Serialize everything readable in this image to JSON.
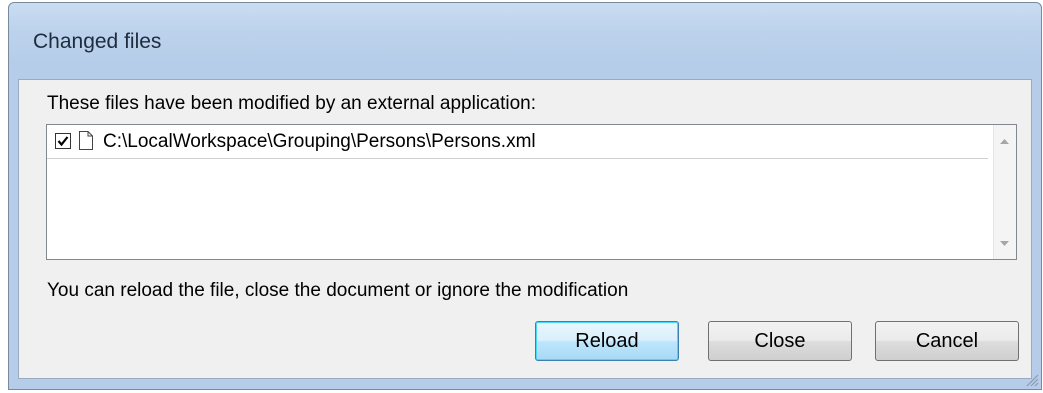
{
  "window": {
    "title": "Changed files"
  },
  "dialog": {
    "prompt": "These files have been modified by an external application:",
    "files": [
      {
        "path": "C:\\LocalWorkspace\\Grouping\\Persons\\Persons.xml",
        "checked": true,
        "icon": "document-icon"
      }
    ],
    "info": "You can reload the file, close the document or ignore the modification"
  },
  "buttons": {
    "reload": "Reload",
    "close": "Close",
    "cancel": "Cancel"
  },
  "colors": {
    "title_bar": "#bcd2ec",
    "default_button_border": "#3c7fb1"
  }
}
